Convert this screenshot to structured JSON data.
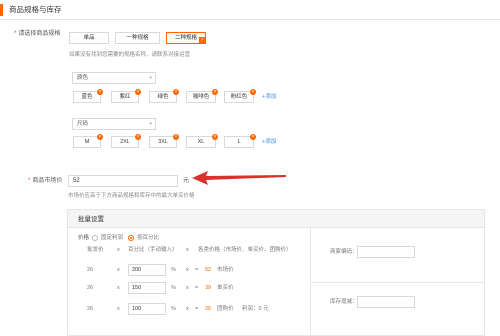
{
  "header": {
    "title": "商品规格与库存"
  },
  "spec": {
    "label": "请选择商品规格",
    "types": [
      "单品",
      "一种规格",
      "二种规格"
    ],
    "hint": "如果没有找到您需要的规格名称，请联系对接运营",
    "add_label": "+添加",
    "groups": [
      {
        "name": "颜色",
        "values": [
          "蓝色",
          "紫红",
          "绿色",
          "咖啡色",
          "粉红色"
        ]
      },
      {
        "name": "尺码",
        "values": [
          "M",
          "2XL",
          "3XL",
          "XL",
          "L"
        ]
      }
    ]
  },
  "price": {
    "label": "商品市场价",
    "value": "52",
    "unit": "元",
    "hint": "市场价应高于下方商品规格和库存中的最大单买价格"
  },
  "batch": {
    "title": "批量设置",
    "price_label": "价格",
    "radio_fixed": "固定利润",
    "radio_percent": "按百分比",
    "col_base": "批发价",
    "col_percent": "百分比（手动输入）",
    "col_prices": "各类价格（市场价、单买价、团购价）",
    "x": "x",
    "pct": "%",
    "eq": "=",
    "rows": [
      {
        "base": "26",
        "percent": "200",
        "result": "52",
        "kind": "市场价",
        "profit": ""
      },
      {
        "base": "26",
        "percent": "150",
        "result": "39",
        "kind": "单买价",
        "profit": ""
      },
      {
        "base": "26",
        "percent": "100",
        "result": "26",
        "kind": "团购价",
        "profit": "利润：0 元"
      }
    ],
    "merchant_code_label": "商家编码：",
    "stock_label": "库存增减："
  },
  "colors": {
    "accent": "#ff6a00",
    "arrow": "#d9322b",
    "link": "#3d8be8"
  }
}
